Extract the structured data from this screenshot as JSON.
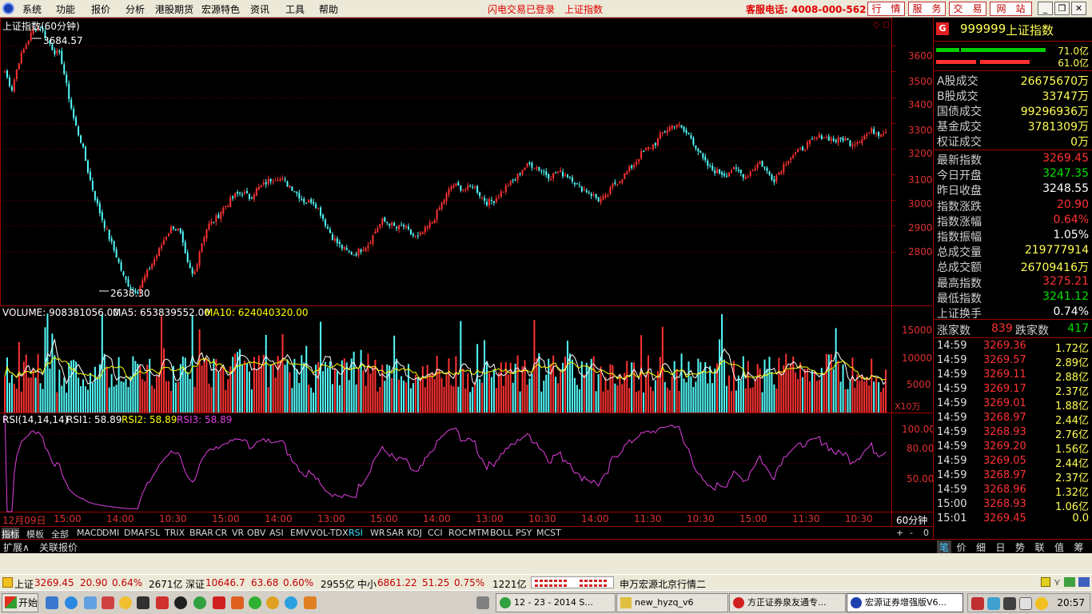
{
  "menu": {
    "items": [
      "系统",
      "功能",
      "报价",
      "分析",
      "港股期货",
      "宏源特色",
      "资讯",
      "工具",
      "帮助"
    ],
    "login_status": "闪电交易已登录",
    "current_index": "上证指数",
    "hotline": "客服电话: 4008-000-562",
    "buttons": [
      "行　情",
      "服　务",
      "交　易",
      "网　站"
    ]
  },
  "chart": {
    "title": "上证指数(60分钟)",
    "high_label": "3684.57",
    "low_label": "2638.30",
    "price_axis": [
      "3600",
      "3500",
      "3400",
      "3300",
      "3200",
      "3100",
      "3000",
      "2900",
      "2800"
    ],
    "volume_header": {
      "volume": "VOLUME: 908381056.00",
      "ma5": "MA5: 653839552.00",
      "ma10": "MA10: 624040320.00"
    },
    "volume_axis": [
      "15000",
      "10000",
      "5000"
    ],
    "volume_unit": "X10万",
    "rsi_header": {
      "name": "RSI(14,14,14)",
      "rsi1": "RSI1: 58.89",
      "rsi2": "RSI2: 58.89",
      "rsi3": "RSI3: 58.89"
    },
    "rsi_axis": [
      "100.00",
      "80.00",
      "50.00"
    ],
    "time_axis": [
      "12月09日",
      "15:00",
      "14:00",
      "10:30",
      "15:00",
      "14:00",
      "13:00",
      "15:00",
      "14:00",
      "13:00",
      "10:30",
      "14:00",
      "11:30",
      "10:30",
      "15:00",
      "11:30",
      "10:30"
    ],
    "period": "60分钟",
    "colors": {
      "up": "#ff3232",
      "down": "#54fcfc",
      "rsi": "#e040e0",
      "ma5": "#ffffff",
      "ma10": "#ffff00"
    }
  },
  "chart_data": {
    "type": "candlestick",
    "title": "上证指数(60分钟)",
    "ylim": [
      2600,
      3700
    ],
    "high": 3684.57,
    "low": 2638.3,
    "last": 3269.45,
    "close_path": [
      3500,
      3430,
      3540,
      3600,
      3660,
      3680,
      3630,
      3580,
      3560,
      3420,
      3300,
      3220,
      3100,
      3000,
      2920,
      2850,
      2780,
      2700,
      2660,
      2645,
      2700,
      2750,
      2800,
      2860,
      2900,
      2880,
      2760,
      2700,
      2820,
      2900,
      2920,
      2960,
      2990,
      3020,
      3030,
      3010,
      3040,
      3060,
      3080,
      3090,
      3070,
      3050,
      3020,
      2990,
      3000,
      2960,
      2900,
      2850,
      2820,
      2800,
      2790,
      2810,
      2830,
      2880,
      2920,
      2910,
      2890,
      2900,
      2870,
      2850,
      2880,
      2910,
      2960,
      3010,
      3060,
      3050,
      3040,
      3060,
      3020,
      2990,
      3000,
      3030,
      3060,
      3080,
      3120,
      3140,
      3130,
      3110,
      3090,
      3110,
      3100,
      3090,
      3050,
      3040,
      3020,
      3000,
      3010,
      3060,
      3080,
      3110,
      3140,
      3180,
      3200,
      3220,
      3260,
      3280,
      3300,
      3270,
      3250,
      3200,
      3150,
      3120,
      3110,
      3100,
      3120,
      3110,
      3090,
      3120,
      3150,
      3110,
      3080,
      3120,
      3160,
      3180,
      3200,
      3220,
      3240,
      3250,
      3240,
      3230,
      3240,
      3220,
      3230,
      3250,
      3270,
      3260,
      3269.45
    ],
    "volume_ylim": [
      0,
      16000
    ],
    "volume_unit": "X10万",
    "rsi_ylim": [
      0,
      100
    ]
  },
  "quote_panel": {
    "code": "999999",
    "name": "上证指数",
    "bar_values": [
      "71.0亿",
      "61.0亿"
    ],
    "volume_rows": [
      {
        "k": "A股成交",
        "v": "26675670万"
      },
      {
        "k": "B股成交",
        "v": "33747万"
      },
      {
        "k": "国债成交",
        "v": "99296936万"
      },
      {
        "k": "基金成交",
        "v": "3781309万"
      },
      {
        "k": "权证成交",
        "v": "0万"
      }
    ],
    "stat_rows": [
      {
        "k": "最新指数",
        "v": "3269.45",
        "c": "#ff3232"
      },
      {
        "k": "今日开盘",
        "v": "3247.35",
        "c": "#00e000"
      },
      {
        "k": "昨日收盘",
        "v": "3248.55",
        "c": "#ffffff"
      },
      {
        "k": "指数涨跌",
        "v": "20.90",
        "c": "#ff3232"
      },
      {
        "k": "指数涨幅",
        "v": "0.64%",
        "c": "#ff3232"
      },
      {
        "k": "指数振幅",
        "v": "1.05%",
        "c": "#ffffff"
      },
      {
        "k": "总成交量",
        "v": "219777914",
        "c": "#ffff54"
      },
      {
        "k": "总成交额",
        "v": "26709416万",
        "c": "#ffff54"
      },
      {
        "k": "最高指数",
        "v": "3275.21",
        "c": "#ff3232"
      },
      {
        "k": "最低指数",
        "v": "3241.12",
        "c": "#00e000"
      },
      {
        "k": "上证换手",
        "v": "0.74%",
        "c": "#ffffff"
      }
    ],
    "up_label": "涨家数",
    "up_count": "839",
    "down_label": "跌家数",
    "down_count": "417",
    "ticks": [
      {
        "t": "14:59",
        "p": "3269.36",
        "a": "1.72亿"
      },
      {
        "t": "14:59",
        "p": "3269.57",
        "a": "2.89亿"
      },
      {
        "t": "14:59",
        "p": "3269.11",
        "a": "2.88亿"
      },
      {
        "t": "14:59",
        "p": "3269.17",
        "a": "2.37亿"
      },
      {
        "t": "14:59",
        "p": "3269.01",
        "a": "1.88亿"
      },
      {
        "t": "14:59",
        "p": "3268.97",
        "a": "2.44亿"
      },
      {
        "t": "14:59",
        "p": "3268.93",
        "a": "2.76亿"
      },
      {
        "t": "14:59",
        "p": "3269.20",
        "a": "1.56亿"
      },
      {
        "t": "14:59",
        "p": "3269.05",
        "a": "2.44亿"
      },
      {
        "t": "14:59",
        "p": "3268.97",
        "a": "2.37亿"
      },
      {
        "t": "14:59",
        "p": "3268.96",
        "a": "1.32亿"
      },
      {
        "t": "15:00",
        "p": "3268.93",
        "a": "1.06亿"
      },
      {
        "t": "15:01",
        "p": "3269.45",
        "a": "0.0"
      }
    ],
    "tabs": [
      "笔",
      "价",
      "细",
      "日",
      "势",
      "联",
      "值",
      "筹"
    ]
  },
  "indicator_tabs": [
    "指标",
    "模板",
    "全部",
    "MACD",
    "DMI",
    "DMA",
    "FSL",
    "TRIX",
    "BRAR",
    "CR",
    "VR",
    "OBV",
    "ASI",
    "EMV",
    "VOL-TDX",
    "RSI",
    "WR",
    "SAR",
    "KDJ",
    "CCI",
    "ROC",
    "MTM",
    "BOLL",
    "PSY",
    "MCST"
  ],
  "zoom_controls": [
    "+",
    "-",
    "0"
  ],
  "bottom_tabs": [
    "扩展∧",
    "关联报价"
  ],
  "quote_bar": {
    "sh": {
      "label": "上证",
      "price": "3269.45",
      "chg": "20.90",
      "pct": "0.64%",
      "amt": "2671亿"
    },
    "sz": {
      "label": "深证",
      "price": "10646.7",
      "chg": "63.68",
      "pct": "0.60%",
      "amt": "2955亿"
    },
    "zx": {
      "label": "中小",
      "price": "6861.22",
      "chg": "51.25",
      "pct": "0.75%",
      "amt": "1221亿"
    },
    "server": "申万宏源北京行情二"
  },
  "taskbar": {
    "start": "开始",
    "tasks": [
      "12 - 23 - 2014 S...",
      "new_hyzq_v6",
      "方正证券泉友通专...",
      "宏源证券增强版V6..."
    ],
    "clock": "20:57"
  }
}
